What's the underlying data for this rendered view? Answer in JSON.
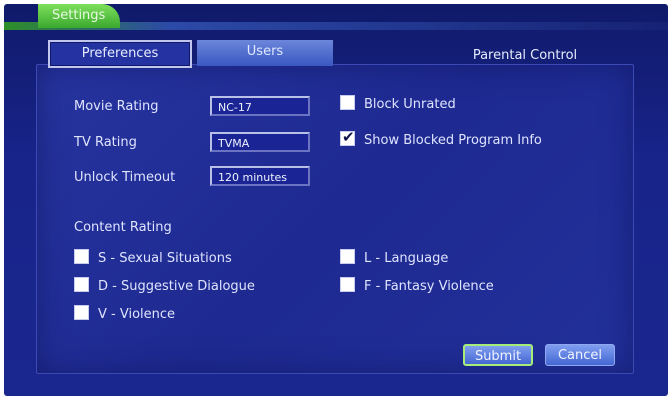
{
  "header": {
    "settings_tab": "Settings"
  },
  "tabs": {
    "preferences": "Preferences",
    "users": "Users",
    "parental_control": "Parental Control"
  },
  "fields": {
    "movie_rating": {
      "label": "Movie Rating",
      "value": "NC-17"
    },
    "tv_rating": {
      "label": "TV Rating",
      "value": "TVMA"
    },
    "unlock_timeout": {
      "label": "Unlock Timeout",
      "value": "120 minutes"
    }
  },
  "options": {
    "block_unrated": {
      "label": "Block Unrated",
      "checked": false
    },
    "show_blocked_info": {
      "label": "Show Blocked Program Info",
      "checked": true
    }
  },
  "content_rating": {
    "title": "Content Rating",
    "items": [
      {
        "label": "S - Sexual Situations",
        "checked": false
      },
      {
        "label": "D - Suggestive Dialogue",
        "checked": false
      },
      {
        "label": "V - Violence",
        "checked": false
      },
      {
        "label": "L - Language",
        "checked": false
      },
      {
        "label": "F - Fantasy Violence",
        "checked": false
      }
    ]
  },
  "buttons": {
    "submit": "Submit",
    "cancel": "Cancel"
  },
  "icons": {
    "check": "checkmark-icon"
  }
}
